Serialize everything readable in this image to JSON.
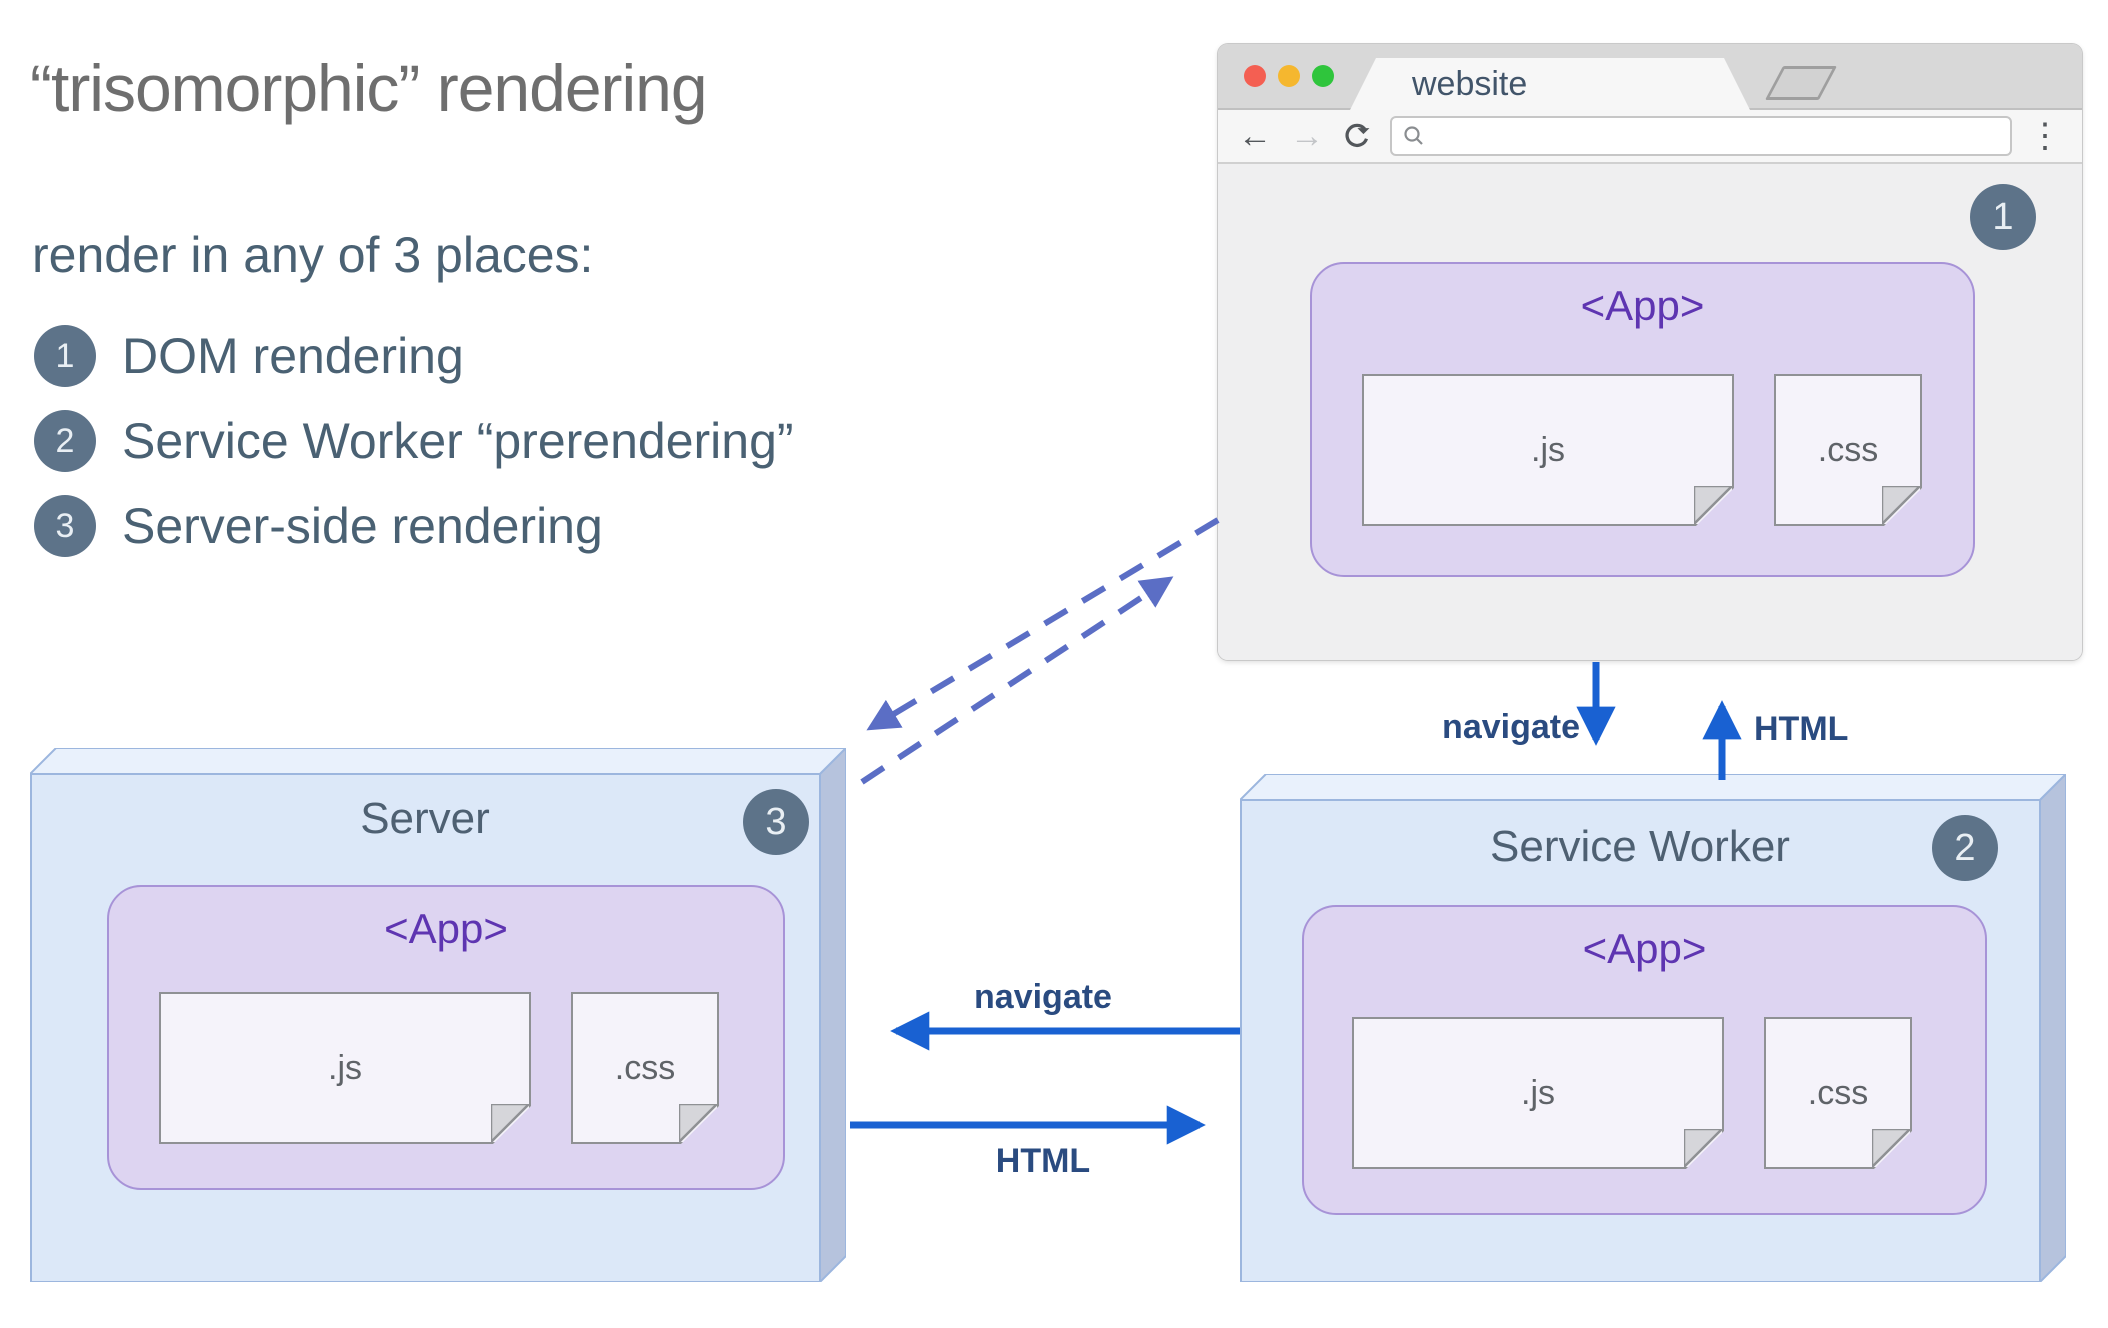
{
  "intro": {
    "title": "“trisomorphic” rendering",
    "subtitle": "render in any of 3 places:",
    "items": [
      {
        "num": "1",
        "label": "DOM rendering"
      },
      {
        "num": "2",
        "label": "Service Worker “prerendering”"
      },
      {
        "num": "3",
        "label": "Server-side rendering"
      }
    ]
  },
  "browser": {
    "tab_title": "website",
    "url_value": "",
    "badge": "1",
    "app": {
      "tag": "<App>",
      "js": ".js",
      "css": ".css"
    }
  },
  "server": {
    "name": "Server",
    "badge": "3",
    "app": {
      "tag": "<App>",
      "js": ".js",
      "css": ".css"
    }
  },
  "service_worker": {
    "name": "Service Worker",
    "badge": "2",
    "app": {
      "tag": "<App>",
      "js": ".js",
      "css": ".css"
    }
  },
  "edges": {
    "browser_to_sw": "navigate",
    "sw_to_browser": "HTML",
    "sw_to_server": "navigate",
    "server_to_sw": "HTML"
  },
  "icons": {
    "back": "←",
    "forward": "→",
    "menu": "⋮"
  },
  "colors": {
    "arrow_blue": "#1961d2",
    "dashed_blue": "#5b6ec5",
    "label_navy": "#2a4b80",
    "box_fill": "#dce8f8",
    "box_top": "#e9f1fc",
    "box_side": "#b6c3dd",
    "box_border": "#9cb6de",
    "app_fill": "#ddd4f1",
    "app_border": "#a793d7",
    "app_text": "#5e35b1",
    "doc_fill": "#f5f3fa",
    "badge_bg": "#5d7389",
    "slate_text": "#4a6173",
    "title_gray": "#6e6e6e",
    "traffic_red": "#f45f52",
    "traffic_yellow": "#f5b72f",
    "traffic_green": "#2fc53c"
  }
}
